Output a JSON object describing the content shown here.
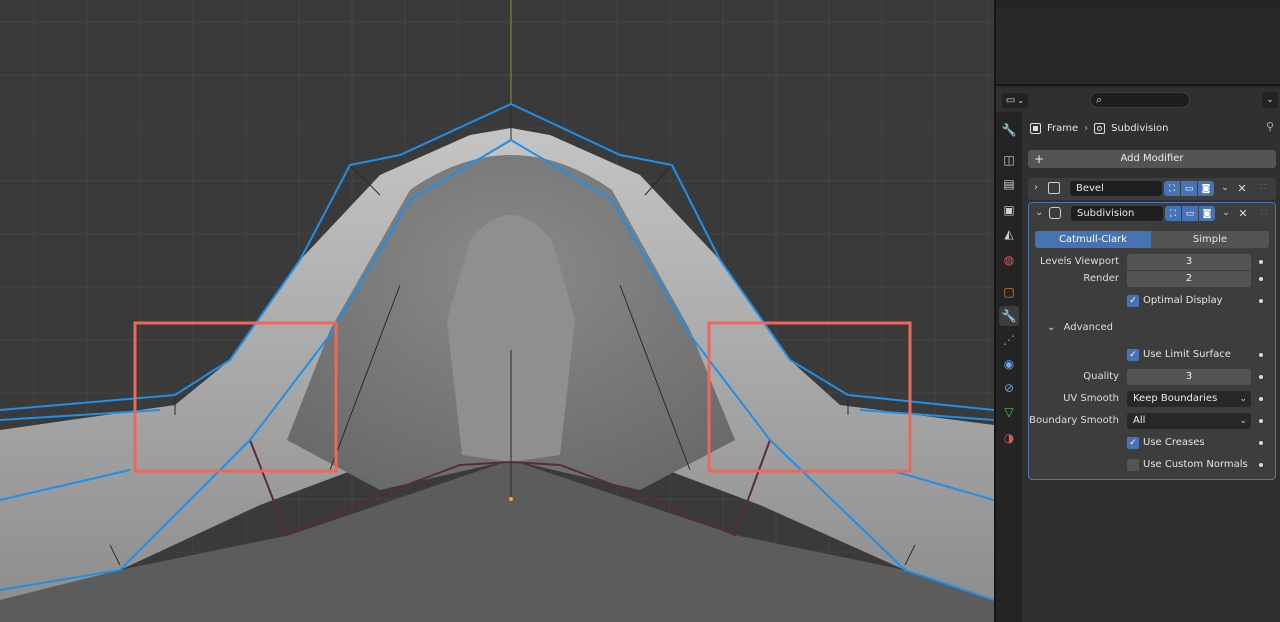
{
  "viewport": {
    "name": "3D Viewport",
    "colors": {
      "background": "#3a3a3a",
      "grid": "#474747",
      "axis_green": "#7e9a2e",
      "axis_red": "#b84545",
      "cage_edge": "#1f8fe8",
      "mesh": "#a9a9a9",
      "highlight_box": "#f0665a"
    }
  },
  "header": {
    "editor_type_icon": "properties-editor-icon",
    "search_placeholder": "",
    "search_icon": "⌕"
  },
  "tabs": [
    {
      "name": "tool-icon",
      "glyph": "🔧"
    },
    {
      "name": "render-icon",
      "glyph": "◫"
    },
    {
      "name": "output-icon",
      "glyph": "▤"
    },
    {
      "name": "view-layer-icon",
      "glyph": "▣"
    },
    {
      "name": "scene-icon",
      "glyph": "◭"
    },
    {
      "name": "world-icon",
      "glyph": "◍"
    },
    {
      "name": "object-icon",
      "glyph": "▢"
    },
    {
      "name": "modifier-icon",
      "glyph": "🔧"
    },
    {
      "name": "particles-icon",
      "glyph": "⋰"
    },
    {
      "name": "physics-icon",
      "glyph": "◉"
    },
    {
      "name": "constraints-icon",
      "glyph": "⊘"
    },
    {
      "name": "data-icon",
      "glyph": "▽"
    },
    {
      "name": "material-icon",
      "glyph": "◑"
    }
  ],
  "breadcrumb": {
    "object": "Frame",
    "separator": "›",
    "modifier": "Subdivision"
  },
  "add_modifier": {
    "label": "Add Modifier",
    "plus": "+"
  },
  "modifiers": {
    "bevel": {
      "name": "Bevel",
      "collapsed": true
    },
    "subdivision": {
      "name": "Subdivision",
      "modes": {
        "active": "Catmull-Clark",
        "inactive": "Simple"
      },
      "levels_viewport_label": "Levels Viewport",
      "levels_viewport": "3",
      "render_label": "Render",
      "render": "2",
      "optimal_display_label": "Optimal Display",
      "optimal_display": true,
      "advanced_label": "Advanced",
      "use_limit_surface_label": "Use Limit Surface",
      "use_limit_surface": true,
      "quality_label": "Quality",
      "quality": "3",
      "uv_smooth_label": "UV Smooth",
      "uv_smooth": "Keep Boundaries",
      "boundary_smooth_label": "Boundary Smooth",
      "boundary_smooth": "All",
      "use_creases_label": "Use Creases",
      "use_creases": true,
      "use_custom_normals_label": "Use Custom Normals",
      "use_custom_normals": false
    }
  },
  "glyphs": {
    "chevron_right": "›",
    "chevron_down": "⌄",
    "close": "✕",
    "check": "✓",
    "grip": "∷",
    "pin": "⚲",
    "dropdown": "⌄"
  }
}
